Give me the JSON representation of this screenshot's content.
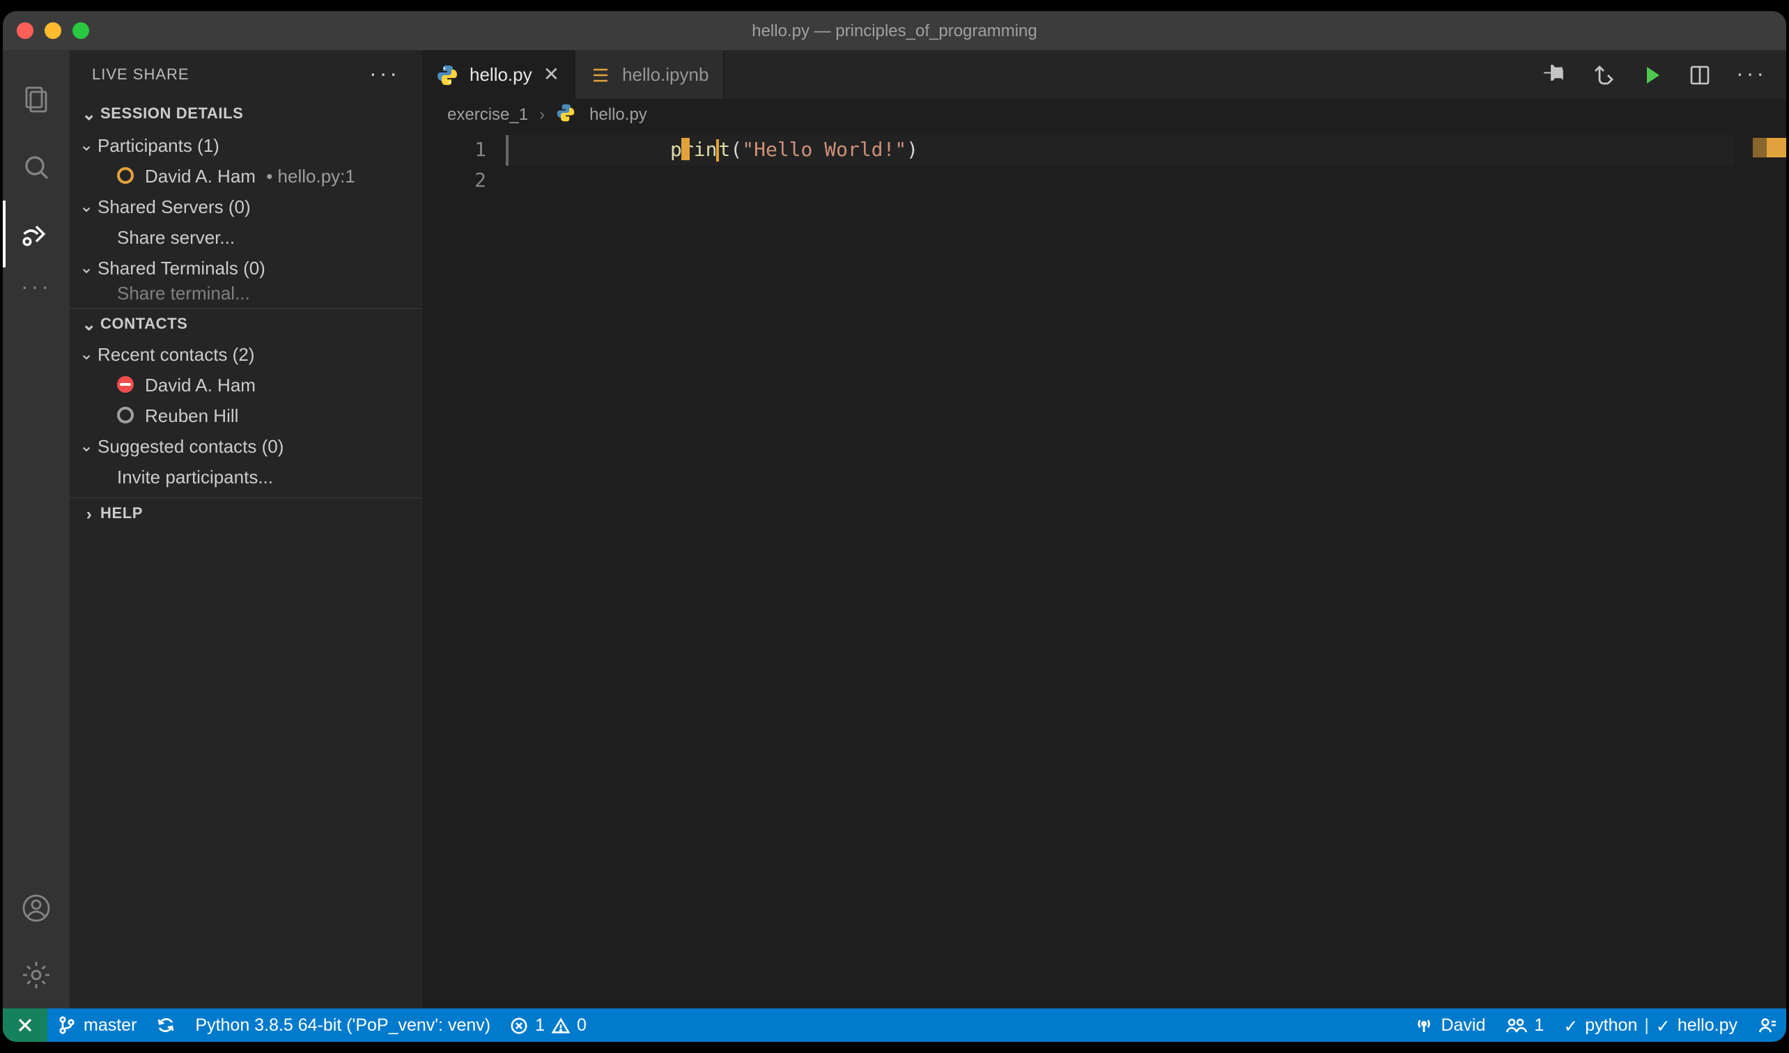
{
  "window": {
    "title": "hello.py — principles_of_programming"
  },
  "sidebar": {
    "title": "LIVE SHARE",
    "sections": {
      "session": {
        "label": "SESSION DETAILS",
        "participants_label": "Participants (1)",
        "participant_name": "David A. Ham",
        "participant_location": "hello.py:1",
        "shared_servers_label": "Shared Servers (0)",
        "share_server_action": "Share server...",
        "shared_terminals_label": "Shared Terminals (0)",
        "share_terminal_action": "Share terminal..."
      },
      "contacts": {
        "label": "CONTACTS",
        "recent_label": "Recent contacts (2)",
        "recent_0": "David A. Ham",
        "recent_1": "Reuben Hill",
        "suggested_label": "Suggested contacts (0)",
        "invite_action": "Invite participants..."
      },
      "help": {
        "label": "HELP"
      }
    }
  },
  "tabs": {
    "active": {
      "label": "hello.py"
    },
    "second": {
      "label": "hello.ipynb"
    }
  },
  "breadcrumb": {
    "folder": "exercise_1",
    "file": "hello.py"
  },
  "code": {
    "line1_fn": "print",
    "line1_open": "(",
    "line1_str": "\"Hello World!\"",
    "line1_close": ")",
    "gutter1": "1",
    "gutter2": "2"
  },
  "statusbar": {
    "branch": "master",
    "python": "Python 3.8.5 64-bit ('PoP_venv': venv)",
    "errors": "1",
    "warnings": "0",
    "liveshare_user": "David",
    "participants_count": "1",
    "lang": "python",
    "file": "hello.py"
  }
}
